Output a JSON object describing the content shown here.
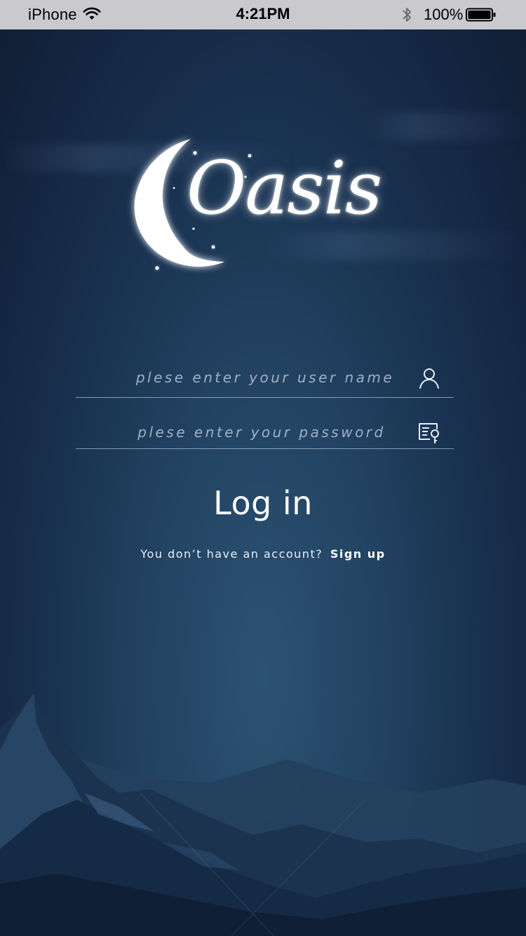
{
  "status_bar": {
    "carrier": "iPhone",
    "time": "4:21PM",
    "battery_percent": "100%",
    "icons": [
      "wifi-icon",
      "bluetooth-icon",
      "battery-icon"
    ]
  },
  "logo": {
    "text": "Oasis",
    "icon": "crescent-moon-icon"
  },
  "login_form": {
    "username_placeholder": "plese enter your user name",
    "username_icon": "user-icon",
    "password_placeholder": "plese enter your password",
    "password_icon": "password-key-icon",
    "login_label": "Log in"
  },
  "signup": {
    "prompt": "You don’t have an account?",
    "link_label": "Sign up"
  },
  "colors": {
    "background_top": "#111d33",
    "background_center": "#2c5273",
    "status_bar": "#c9c9ce",
    "text": "#ffffff"
  }
}
